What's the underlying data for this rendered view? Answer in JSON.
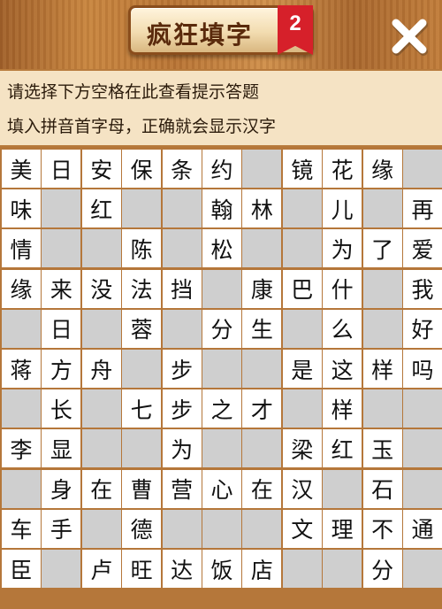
{
  "header": {
    "title": "疯狂填字",
    "badge": "2",
    "close_icon": "close-icon"
  },
  "hints": {
    "line1": "请选择下方空格在此查看提示答题",
    "line2": "填入拼音首字母，正确就会显示汉字"
  },
  "colors": {
    "wood": "#c8853f",
    "grid_line": "#b5773a",
    "blank_cell": "#cfcfcf",
    "filled_cell": "#ffffff",
    "badge": "#d6202a"
  },
  "grid": [
    [
      "美",
      "日",
      "安",
      "保",
      "条",
      "约",
      "#",
      "镜",
      "花",
      "缘",
      "#"
    ],
    [
      "味",
      "#",
      "红",
      "#",
      "#",
      "翰",
      "林",
      "#",
      "儿",
      "#",
      "再"
    ],
    [
      "情",
      "#",
      "#",
      "陈",
      "#",
      "松",
      "#",
      "#",
      "为",
      "了",
      "爱"
    ],
    [
      "缘",
      "来",
      "没",
      "法",
      "挡",
      "#",
      "康",
      "巴",
      "什",
      "#",
      "我"
    ],
    [
      "#",
      "日",
      "#",
      "蓉",
      "#",
      "分",
      "生",
      "#",
      "么",
      "#",
      "好"
    ],
    [
      "蒋",
      "方",
      "舟",
      "#",
      "步",
      "#",
      "#",
      "是",
      "这",
      "样",
      "吗"
    ],
    [
      "#",
      "长",
      "#",
      "七",
      "步",
      "之",
      "才",
      "#",
      "样",
      "#",
      "#"
    ],
    [
      "李",
      "显",
      "#",
      "#",
      "为",
      "#",
      "#",
      "梁",
      "红",
      "玉",
      "#"
    ],
    [
      "#",
      "身",
      "在",
      "曹",
      "营",
      "心",
      "在",
      "汉",
      "#",
      "石",
      "#"
    ],
    [
      "车",
      "手",
      "#",
      "德",
      "#",
      "#",
      "#",
      "文",
      "理",
      "不",
      "通"
    ],
    [
      "臣",
      "#",
      "卢",
      "旺",
      "达",
      "饭",
      "店",
      "#",
      "#",
      "分",
      "#"
    ]
  ]
}
